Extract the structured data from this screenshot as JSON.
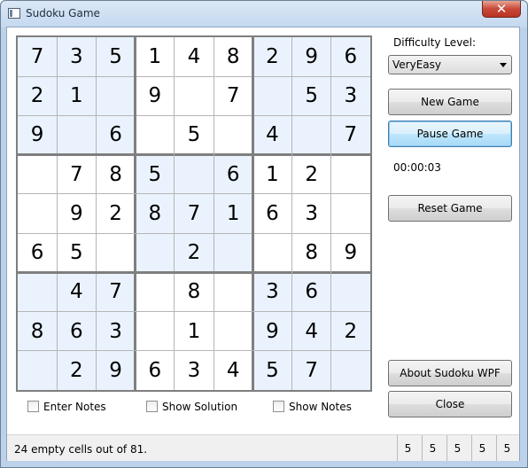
{
  "window": {
    "title": "Sudoku Game"
  },
  "board": {
    "cells": [
      [
        "7",
        "3",
        "5",
        "1",
        "4",
        "8",
        "2",
        "9",
        "6"
      ],
      [
        "2",
        "1",
        "",
        "9",
        "",
        "7",
        "",
        "5",
        "3"
      ],
      [
        "9",
        "",
        "6",
        "",
        "5",
        "",
        "4",
        "",
        "7"
      ],
      [
        "",
        "7",
        "8",
        "5",
        "",
        "6",
        "1",
        "2",
        ""
      ],
      [
        "",
        "9",
        "2",
        "8",
        "7",
        "1",
        "6",
        "3",
        ""
      ],
      [
        "6",
        "5",
        "",
        "",
        "2",
        "",
        "",
        "8",
        "9"
      ],
      [
        "",
        "4",
        "7",
        "",
        "8",
        "",
        "3",
        "6",
        ""
      ],
      [
        "8",
        "6",
        "3",
        "",
        "1",
        "",
        "9",
        "4",
        "2"
      ],
      [
        "",
        "2",
        "9",
        "6",
        "3",
        "4",
        "5",
        "7",
        ""
      ]
    ]
  },
  "sidebar": {
    "difficulty_label": "Difficulty Level:",
    "difficulty_value": "VeryEasy",
    "new_game": "New Game",
    "pause_game": "Pause Game",
    "timer": "00:00:03",
    "reset_game": "Reset Game",
    "about": "About Sudoku WPF",
    "close": "Close"
  },
  "options": {
    "enter_notes": "Enter Notes",
    "show_solution": "Show Solution",
    "show_notes": "Show Notes"
  },
  "status": {
    "text": "24 empty cells out of 81.",
    "counts": [
      "5",
      "5",
      "5",
      "5",
      "5"
    ]
  },
  "colors": {
    "shade": "#eaf3fd",
    "title_bar": "#c4d8ef",
    "focus": "#3c7fb1"
  }
}
